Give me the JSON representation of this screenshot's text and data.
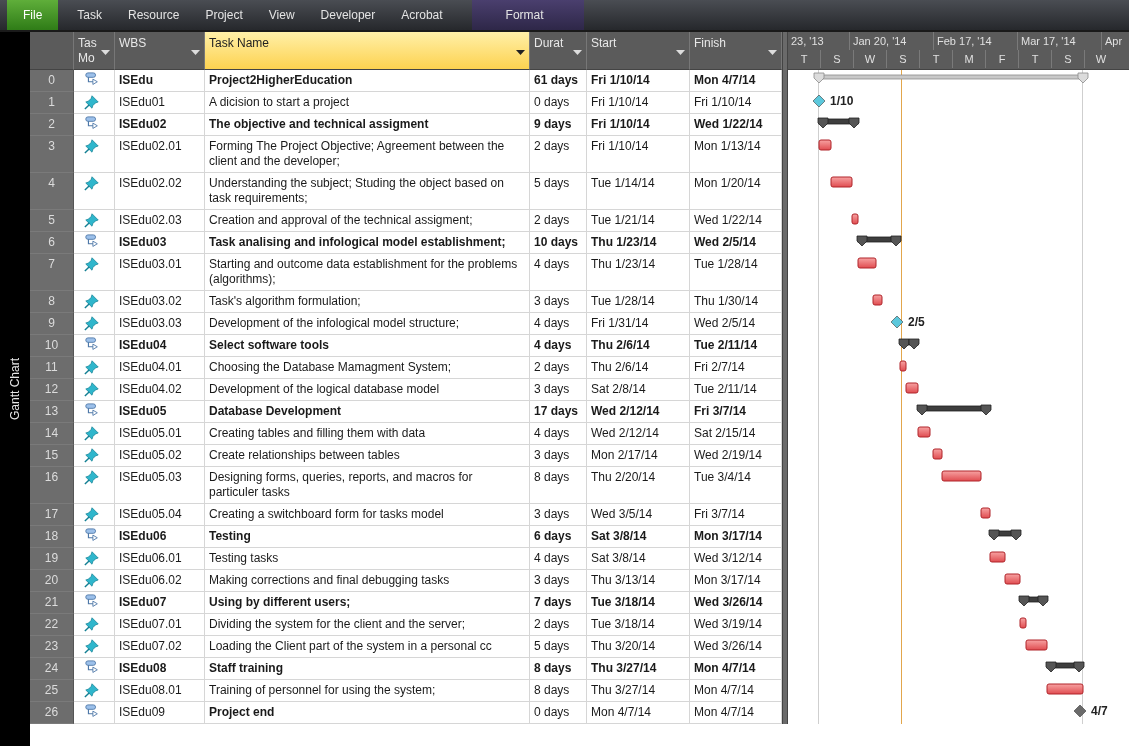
{
  "ribbon": {
    "tabs": [
      {
        "label": "File",
        "kind": "file"
      },
      {
        "label": "Task",
        "kind": "tab"
      },
      {
        "label": "Resource",
        "kind": "tab"
      },
      {
        "label": "Project",
        "kind": "tab"
      },
      {
        "label": "View",
        "kind": "tab"
      },
      {
        "label": "Developer",
        "kind": "tab"
      },
      {
        "label": "Acrobat",
        "kind": "tab"
      },
      {
        "label": "Format",
        "kind": "context"
      }
    ]
  },
  "view_label": "Gantt Chart",
  "table": {
    "columns": [
      {
        "label": "Tas Mo",
        "selected": false
      },
      {
        "label": "WBS",
        "selected": false
      },
      {
        "label": "Task Name",
        "selected": true
      },
      {
        "label": "Durat",
        "selected": false
      },
      {
        "label": "Start",
        "selected": false
      },
      {
        "label": "Finish",
        "selected": false
      }
    ],
    "rows": [
      {
        "id": "0",
        "mode": {
          "kind": "auto"
        },
        "wbs": "ISEdu",
        "name": "Project2HigherEducation",
        "duration": "61 days",
        "start": "Fri 1/10/14",
        "finish": "Mon 4/7/14",
        "summary": true,
        "bar": {
          "kind": "project"
        }
      },
      {
        "id": "1",
        "mode": {
          "kind": "manual"
        },
        "wbs": "ISEdu01",
        "name": "A dicision to start a project",
        "duration": "0 days",
        "start": "Fri 1/10/14",
        "finish": "Fri 1/10/14",
        "summary": false,
        "bar": {
          "kind": "milestone",
          "label": "1/10",
          "color": "#5cc8dc"
        }
      },
      {
        "id": "2",
        "mode": {
          "kind": "auto"
        },
        "wbs": "ISEdu02",
        "name": "The objective and technical assigment",
        "duration": "9 days",
        "start": "Fri 1/10/14",
        "finish": "Wed 1/22/14",
        "summary": true,
        "bar": {
          "kind": "summary"
        }
      },
      {
        "id": "3",
        "mode": {
          "kind": "manual"
        },
        "wbs": "ISEdu02.01",
        "name": "Forming The Project Objective; Agreement between the client and the developer;",
        "duration": "2 days",
        "start": "Fri 1/10/14",
        "finish": "Mon 1/13/14",
        "summary": false,
        "bar": {
          "kind": "task"
        }
      },
      {
        "id": "4",
        "mode": {
          "kind": "manual"
        },
        "wbs": "ISEdu02.02",
        "name": "Understanding the subject; Studing the object based on task requirements;",
        "duration": "5 days",
        "start": "Tue 1/14/14",
        "finish": "Mon 1/20/14",
        "summary": false,
        "bar": {
          "kind": "task"
        }
      },
      {
        "id": "5",
        "mode": {
          "kind": "manual"
        },
        "wbs": "ISEdu02.03",
        "name": "Creation and approval of the technical assigment;",
        "duration": "2 days",
        "start": "Tue 1/21/14",
        "finish": "Wed 1/22/14",
        "summary": false,
        "bar": {
          "kind": "task"
        }
      },
      {
        "id": "6",
        "mode": {
          "kind": "auto"
        },
        "wbs": "ISEdu03",
        "name": "Task analising and infological model establishment;",
        "duration": "10 days",
        "start": "Thu 1/23/14",
        "finish": "Wed 2/5/14",
        "summary": true,
        "bar": {
          "kind": "summary"
        }
      },
      {
        "id": "7",
        "mode": {
          "kind": "manual"
        },
        "wbs": "ISEdu03.01",
        "name": "Starting and outcome data establishment for the problems (algorithms);",
        "duration": "4 days",
        "start": "Thu 1/23/14",
        "finish": "Tue 1/28/14",
        "summary": false,
        "bar": {
          "kind": "task"
        }
      },
      {
        "id": "8",
        "mode": {
          "kind": "manual"
        },
        "wbs": "ISEdu03.02",
        "name": "Task's algorithm formulation;",
        "duration": "3 days",
        "start": "Tue 1/28/14",
        "finish": "Thu 1/30/14",
        "summary": false,
        "bar": {
          "kind": "task"
        }
      },
      {
        "id": "9",
        "mode": {
          "kind": "manual"
        },
        "wbs": "ISEdu03.03",
        "name": "Development of the infological model structure;",
        "duration": "4 days",
        "start": "Fri 1/31/14",
        "finish": "Wed 2/5/14",
        "summary": false,
        "bar": {
          "kind": "milestone",
          "label": "2/5",
          "color": "#5cc8dc"
        }
      },
      {
        "id": "10",
        "mode": {
          "kind": "auto"
        },
        "wbs": "ISEdu04",
        "name": "Select software tools",
        "duration": "4 days",
        "start": "Thu 2/6/14",
        "finish": "Tue 2/11/14",
        "summary": true,
        "bar": {
          "kind": "summary"
        }
      },
      {
        "id": "11",
        "mode": {
          "kind": "manual"
        },
        "wbs": "ISEdu04.01",
        "name": "Choosing the Database Mamagment System;",
        "duration": "2 days",
        "start": "Thu 2/6/14",
        "finish": "Fri 2/7/14",
        "summary": false,
        "bar": {
          "kind": "task"
        }
      },
      {
        "id": "12",
        "mode": {
          "kind": "manual"
        },
        "wbs": "ISEdu04.02",
        "name": "Development of the logical database model",
        "duration": "3 days",
        "start": "Sat 2/8/14",
        "finish": "Tue 2/11/14",
        "summary": false,
        "bar": {
          "kind": "task"
        }
      },
      {
        "id": "13",
        "mode": {
          "kind": "auto"
        },
        "wbs": "ISEdu05",
        "name": "Database Development",
        "duration": "17 days",
        "start": "Wed 2/12/14",
        "finish": "Fri 3/7/14",
        "summary": true,
        "bar": {
          "kind": "summary"
        }
      },
      {
        "id": "14",
        "mode": {
          "kind": "manual"
        },
        "wbs": "ISEdu05.01",
        "name": "Creating tables and filling them with data",
        "duration": "4 days",
        "start": "Wed 2/12/14",
        "finish": "Sat 2/15/14",
        "summary": false,
        "bar": {
          "kind": "task"
        }
      },
      {
        "id": "15",
        "mode": {
          "kind": "manual"
        },
        "wbs": "ISEdu05.02",
        "name": "Create relationships between tables",
        "duration": "3 days",
        "start": "Mon 2/17/14",
        "finish": "Wed 2/19/14",
        "summary": false,
        "bar": {
          "kind": "task"
        }
      },
      {
        "id": "16",
        "mode": {
          "kind": "manual"
        },
        "wbs": "ISEdu05.03",
        "name": "Designing forms, queries, reports, and macros for particuler tasks",
        "duration": "8 days",
        "start": "Thu 2/20/14",
        "finish": "Tue 3/4/14",
        "summary": false,
        "bar": {
          "kind": "task"
        }
      },
      {
        "id": "17",
        "mode": {
          "kind": "manual"
        },
        "wbs": "ISEdu05.04",
        "name": "Creating a switchboard form for tasks model",
        "duration": "3 days",
        "start": "Wed 3/5/14",
        "finish": "Fri 3/7/14",
        "summary": false,
        "bar": {
          "kind": "task"
        }
      },
      {
        "id": "18",
        "mode": {
          "kind": "auto"
        },
        "wbs": "ISEdu06",
        "name": "Testing",
        "duration": "6 days",
        "start": "Sat 3/8/14",
        "finish": "Mon 3/17/14",
        "summary": true,
        "bar": {
          "kind": "summary"
        }
      },
      {
        "id": "19",
        "mode": {
          "kind": "manual"
        },
        "wbs": "ISEdu06.01",
        "name": "Testing tasks",
        "duration": "4 days",
        "start": "Sat 3/8/14",
        "finish": "Wed 3/12/14",
        "summary": false,
        "bar": {
          "kind": "task"
        }
      },
      {
        "id": "20",
        "mode": {
          "kind": "manual"
        },
        "wbs": "ISEdu06.02",
        "name": "Making corrections and final debugging tasks",
        "duration": "3 days",
        "start": "Thu 3/13/14",
        "finish": "Mon 3/17/14",
        "summary": false,
        "bar": {
          "kind": "task"
        }
      },
      {
        "id": "21",
        "mode": {
          "kind": "auto"
        },
        "wbs": "ISEdu07",
        "name": "Using by different users;",
        "duration": "7 days",
        "start": "Tue 3/18/14",
        "finish": "Wed 3/26/14",
        "summary": true,
        "bar": {
          "kind": "summary"
        }
      },
      {
        "id": "22",
        "mode": {
          "kind": "manual"
        },
        "wbs": "ISEdu07.01",
        "name": "Dividing the system for the client and the server;",
        "duration": "2 days",
        "start": "Tue 3/18/14",
        "finish": "Wed 3/19/14",
        "summary": false,
        "bar": {
          "kind": "task"
        }
      },
      {
        "id": "23",
        "mode": {
          "kind": "manual"
        },
        "wbs": "ISEdu07.02",
        "name": "Loading the Client part of the system in a personal cc",
        "duration": "5 days",
        "start": "Thu 3/20/14",
        "finish": "Wed 3/26/14",
        "summary": false,
        "bar": {
          "kind": "task"
        }
      },
      {
        "id": "24",
        "mode": {
          "kind": "auto"
        },
        "wbs": "ISEdu08",
        "name": "Staff training",
        "duration": "8 days",
        "start": "Thu 3/27/14",
        "finish": "Mon 4/7/14",
        "summary": true,
        "bar": {
          "kind": "summary"
        }
      },
      {
        "id": "25",
        "mode": {
          "kind": "manual"
        },
        "wbs": "ISEdu08.01",
        "name": "Training of personnel for using the system;",
        "duration": "8 days",
        "start": "Thu 3/27/14",
        "finish": "Mon 4/7/14",
        "summary": false,
        "bar": {
          "kind": "task"
        }
      },
      {
        "id": "26",
        "mode": {
          "kind": "auto"
        },
        "wbs": "ISEdu09",
        "name": "Project end",
        "duration": "0 days",
        "start": "Mon 4/7/14",
        "finish": "Mon 4/7/14",
        "summary": false,
        "name_bold": true,
        "bar": {
          "kind": "milestone",
          "label": "4/7",
          "color": "#6a6a6a"
        }
      }
    ]
  },
  "timescale": {
    "top": [
      "23, '13",
      "Jan 20, '14",
      "Feb 17, '14",
      "Mar 17, '14",
      "Apr"
    ],
    "bottom": [
      "T",
      "S",
      "W",
      "S",
      "T",
      "M",
      "F",
      "T",
      "S",
      "W"
    ]
  }
}
